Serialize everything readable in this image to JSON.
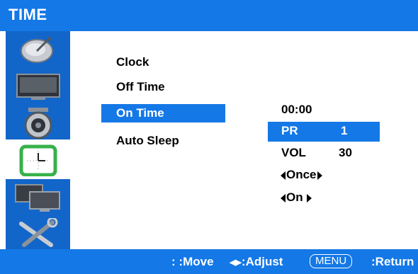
{
  "header": {
    "title": "TIME"
  },
  "sidebar": {
    "items": [
      {
        "icon": "satellite-dish-icon",
        "selected": false
      },
      {
        "icon": "picture-tv-icon",
        "selected": false
      },
      {
        "icon": "speaker-icon",
        "selected": false
      },
      {
        "icon": "clock-calendar-icon",
        "selected": true
      },
      {
        "icon": "monitor-setup-icon",
        "selected": false
      },
      {
        "icon": "tools-icon",
        "selected": false
      }
    ]
  },
  "menu": {
    "items": [
      {
        "label": "Clock"
      },
      {
        "label": "Off Time"
      },
      {
        "label": "On Time",
        "selected": true
      },
      {
        "label": "Auto Sleep"
      }
    ]
  },
  "on_time": {
    "time": "00:00",
    "pr_label": "PR",
    "pr_value": "1",
    "vol_label": "VOL",
    "vol_value": "30",
    "repeat": "Once",
    "state": "On"
  },
  "footer": {
    "move_symbol": ":",
    "move_label": ":Move",
    "adjust_label": ":Adjust",
    "menu_key": "MENU",
    "return_label": ":Return"
  },
  "colors": {
    "accent": "#1478e6",
    "sidebar": "#1366c9",
    "text": "#000000",
    "background": "#ffffff"
  }
}
